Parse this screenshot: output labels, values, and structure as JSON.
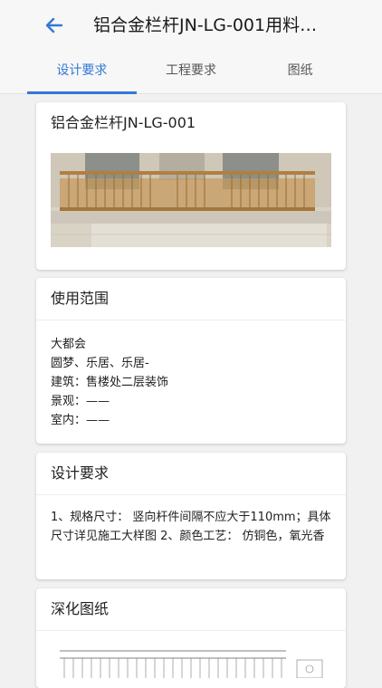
{
  "header": {
    "title": "铝合金栏杆JN-LG-001用料…",
    "tabs": [
      "设计要求",
      "工程要求",
      "图纸"
    ],
    "active_tab_index": 0
  },
  "product_card": {
    "title": "铝合金栏杆JN-LG-001"
  },
  "usage_card": {
    "title": "使用范围",
    "lines": [
      "大都会",
      "圆梦、乐居、乐居-",
      "建筑：售楼处二层装饰",
      "景观：——",
      "室内：——"
    ]
  },
  "design_card": {
    "title": "设计要求",
    "text": "1、规格尺寸： 竖向杆件间隔不应大于110mm；具体尺寸详见施工大样图 2、颜色工艺： 仿铜色，氧光香"
  },
  "drawing_card": {
    "title": "深化图纸"
  },
  "colors": {
    "accent": "#3478d4",
    "background": "#f1f1f1"
  },
  "icons": {
    "back": "arrow-left-icon"
  }
}
